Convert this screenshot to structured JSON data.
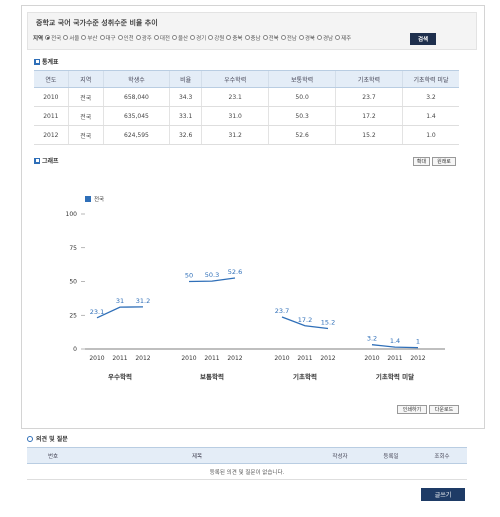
{
  "search": {
    "title": "중학교 국어 국가수준 성취수준 비율 추이",
    "region_label": "지역",
    "regions": [
      {
        "label": "전국",
        "selected": true
      },
      {
        "label": "서울",
        "selected": false
      },
      {
        "label": "부산",
        "selected": false
      },
      {
        "label": "대구",
        "selected": false
      },
      {
        "label": "인천",
        "selected": false
      },
      {
        "label": "광주",
        "selected": false
      },
      {
        "label": "대전",
        "selected": false
      },
      {
        "label": "울산",
        "selected": false
      },
      {
        "label": "경기",
        "selected": false
      },
      {
        "label": "강원",
        "selected": false
      },
      {
        "label": "충북",
        "selected": false
      },
      {
        "label": "충남",
        "selected": false
      },
      {
        "label": "전북",
        "selected": false
      },
      {
        "label": "전남",
        "selected": false
      },
      {
        "label": "경북",
        "selected": false
      },
      {
        "label": "경남",
        "selected": false
      },
      {
        "label": "제주",
        "selected": false
      }
    ],
    "button_label": "검색"
  },
  "stats": {
    "section_title": "통계표",
    "headers": [
      "연도",
      "지역",
      "학생수",
      "비율",
      "우수학력",
      "보통학력",
      "기초학력",
      "기초학력 미달"
    ],
    "rows": [
      [
        "2010",
        "전국",
        "658,040",
        "34.3",
        "23.1",
        "50.0",
        "23.7",
        "3.2"
      ],
      [
        "2011",
        "전국",
        "635,045",
        "33.1",
        "31.0",
        "50.3",
        "17.2",
        "1.4"
      ],
      [
        "2012",
        "전국",
        "624,595",
        "32.6",
        "31.2",
        "52.6",
        "15.2",
        "1.0"
      ]
    ]
  },
  "graph": {
    "section_title": "그래프",
    "zoom_in_label": "확대",
    "reset_label": "원래로",
    "print_label": "인쇄하기",
    "download_label": "다운로드"
  },
  "chart_data": {
    "type": "line",
    "ylim": [
      0,
      100
    ],
    "yticks": [
      "0",
      "25",
      "50",
      "75",
      "100"
    ],
    "legend": "전국",
    "groups": [
      {
        "name": "우수학력",
        "x": [
          "2010",
          "2011",
          "2012"
        ],
        "values": [
          23.1,
          31,
          31.2
        ],
        "labels": [
          "23.1",
          "31",
          "31.2"
        ]
      },
      {
        "name": "보통학력",
        "x": [
          "2010",
          "2011",
          "2012"
        ],
        "values": [
          50,
          50.3,
          52.6
        ],
        "labels": [
          "50",
          "50.3",
          "52.6"
        ]
      },
      {
        "name": "기초학력",
        "x": [
          "2010",
          "2011",
          "2012"
        ],
        "values": [
          23.7,
          17.2,
          15.2
        ],
        "labels": [
          "23.7",
          "17.2",
          "15.2"
        ]
      },
      {
        "name": "기초학력 미달",
        "x": [
          "2010",
          "2011",
          "2012"
        ],
        "values": [
          3.2,
          1.4,
          1
        ],
        "labels": [
          "3.2",
          "1.4",
          "1"
        ]
      }
    ],
    "colors": {
      "line": "#2f6fb8",
      "axis": "#555555"
    }
  },
  "board": {
    "section_title": "의견 및 질문",
    "headers": [
      "번호",
      "제목",
      "작성자",
      "등록일",
      "조회수"
    ],
    "empty_message": "등록된 의견 및 질문이 없습니다.",
    "write_label": "글쓰기"
  }
}
